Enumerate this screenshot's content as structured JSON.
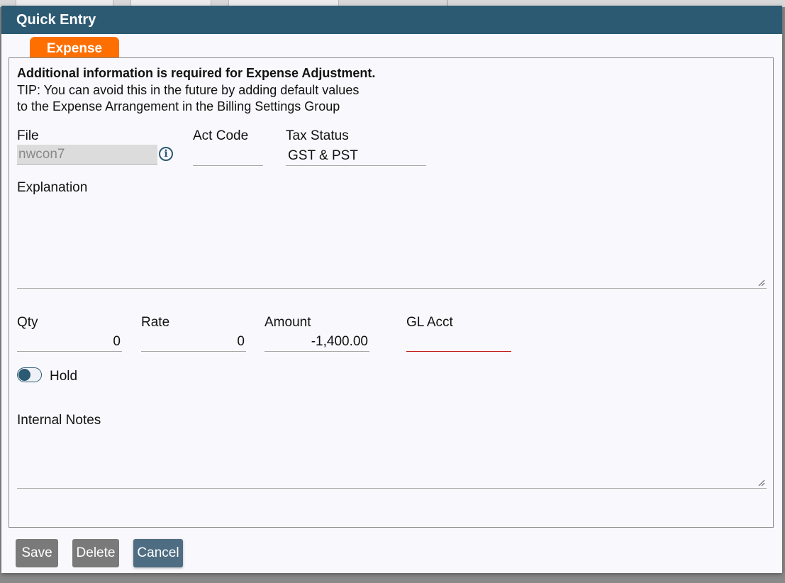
{
  "dialog": {
    "title": "Quick Entry",
    "tab_label": "Expense"
  },
  "notice": {
    "heading": "Additional information is required for Expense Adjustment.",
    "tip_line1": "TIP: You can avoid this in the future by adding default values",
    "tip_line2": "to the Expense Arrangement in the Billing Settings Group"
  },
  "fields": {
    "file_label": "File",
    "file_value": "nwcon7",
    "act_code_label": "Act Code",
    "act_code_value": "",
    "tax_status_label": "Tax Status",
    "tax_status_value": "GST & PST",
    "explanation_label": "Explanation",
    "explanation_value": "",
    "qty_label": "Qty",
    "qty_value": "0",
    "rate_label": "Rate",
    "rate_value": "0",
    "amount_label": "Amount",
    "amount_value": "-1,400.00",
    "gl_acct_label": "GL Acct",
    "gl_acct_value": "",
    "hold_label": "Hold",
    "internal_notes_label": "Internal Notes",
    "internal_notes_value": ""
  },
  "buttons": {
    "save": "Save",
    "delete": "Delete",
    "cancel": "Cancel"
  },
  "colors": {
    "titlebar": "#2d5a73",
    "tab": "#ff6f00",
    "error_underline": "#c21b1b"
  }
}
